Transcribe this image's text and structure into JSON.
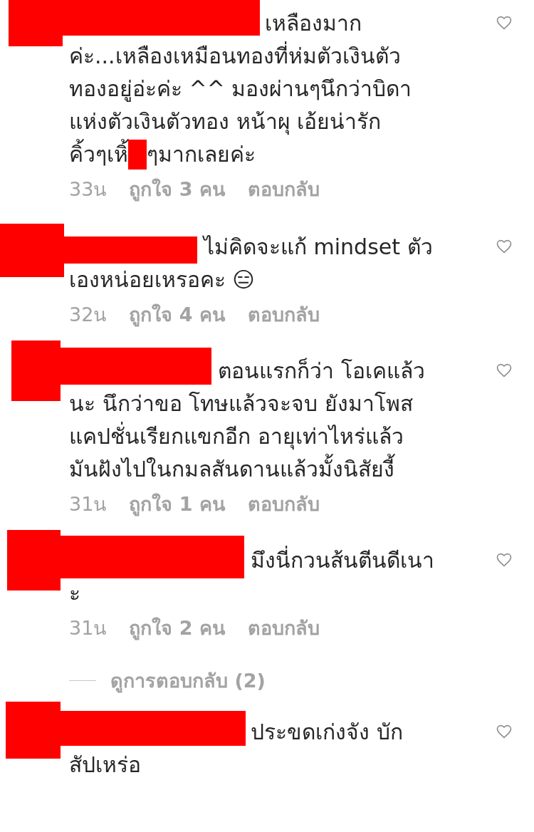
{
  "comments": [
    {
      "lines": [
        [
          "เหลืองมาก"
        ],
        [
          "ค่ะ...เหลืองเหมือนทองที่ห่มตัวเงินตัว"
        ],
        [
          "ทองอยู่อ่ะค่ะ ^^ มองผ่านๆนึกว่าบิดา"
        ],
        [
          "แห่งตัวเงินตัวทอง หน้าผุ เอ้ยน่ารัก"
        ],
        [
          "คิ้วๆเหิ้",
          "ๆมากเลยค่ะ"
        ]
      ],
      "time": "33น",
      "likes": "ถูกใจ 3 คน",
      "reply": "ตอบกลับ",
      "liked": false
    },
    {
      "lines": [
        [
          "ไม่คิดจะแก้ mindset ตัว"
        ],
        [
          "เองหน่อยเหรอคะ 😑"
        ]
      ],
      "time": "32น",
      "likes": "ถูกใจ 4 คน",
      "reply": "ตอบกลับ",
      "liked": false
    },
    {
      "lines": [
        [
          "ตอนแรกก็ว่า โอเคแล้ว"
        ],
        [
          "นะ นึกว่าขอ โทษแล้วจะจบ ยังมาโพส"
        ],
        [
          "แคปชั่นเรียกแขกอีก อายุเท่าไหร่แล้ว"
        ],
        [
          "มันฝังไปในกมลสันดานแล้วมั้งนิสัยงี้"
        ]
      ],
      "time": "31น",
      "likes": "ถูกใจ 1 คน",
      "reply": "ตอบกลับ",
      "liked": false
    },
    {
      "lines": [
        [
          "มึงนี่กวนส้นตีนดีเนา"
        ],
        [
          "ะ"
        ]
      ],
      "time": "31น",
      "likes": "ถูกใจ 2 คน",
      "reply": "ตอบกลับ",
      "liked": false,
      "view_replies": "ดูการตอบกลับ (2)"
    },
    {
      "lines": [
        [
          "ประขดเก่งจัง บัก"
        ],
        [
          "สัปเหร่อ"
        ]
      ],
      "liked": false
    }
  ]
}
